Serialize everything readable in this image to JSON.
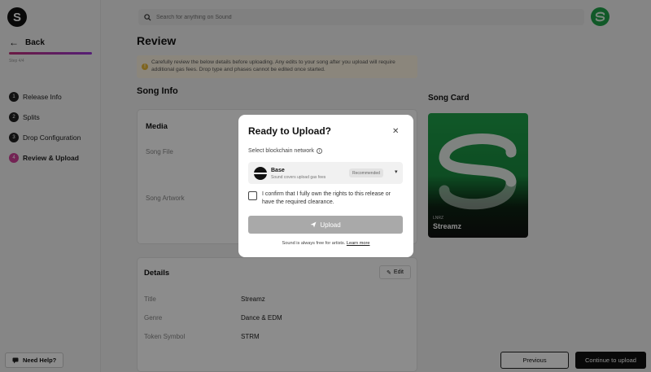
{
  "app": {
    "logo_letter": "S"
  },
  "sidebar": {
    "back_label": "Back",
    "step_count": "Step 4/4",
    "steps": [
      {
        "num": "1",
        "label": "Release Info"
      },
      {
        "num": "2",
        "label": "Splits"
      },
      {
        "num": "3",
        "label": "Drop Configuration"
      },
      {
        "num": "4",
        "label": "Review & Upload"
      }
    ],
    "active_step": 4,
    "help_label": "Need Help?"
  },
  "header": {
    "search_placeholder": "Search for anything on Sound"
  },
  "main": {
    "title": "Review",
    "notice": "Carefully review the below details before uploading. Any edits to your song after you upload will require additional gas fees. Drop type and phases cannot be edited once started.",
    "song_info_heading": "Song Info",
    "media": {
      "title": "Media",
      "song_file_label": "Song File",
      "song_artwork_label": "Song Artwork"
    },
    "details": {
      "title": "Details",
      "edit_label": "Edit",
      "rows": [
        {
          "label": "Title",
          "value": "Streamz"
        },
        {
          "label": "Genre",
          "value": "Dance & EDM"
        },
        {
          "label": "Token Symbol",
          "value": "STRM"
        }
      ]
    },
    "song_card": {
      "heading": "Song Card",
      "artist": "LNRZ",
      "title": "Streamz"
    }
  },
  "footer": {
    "previous_label": "Previous",
    "continue_label": "Continue to upload"
  },
  "modal": {
    "title": "Ready to Upload?",
    "network_label": "Select blockchain network",
    "network": {
      "name": "Base",
      "subtitle": "Sound covers upload gas fees",
      "badge": "Recommended"
    },
    "confirm_text": "I confirm that I fully own the rights to this release or have the required clearance.",
    "confirm_checked": false,
    "upload_label": "Upload",
    "free_text": "Sound is always free for artists.",
    "learn_more_label": "Learn more"
  },
  "colors": {
    "accent_gradient_start": "#c2307a",
    "accent_gradient_end": "#9c37d6",
    "artwork_green": "#1fa24a",
    "upload_disabled": "#a9a9a9"
  }
}
